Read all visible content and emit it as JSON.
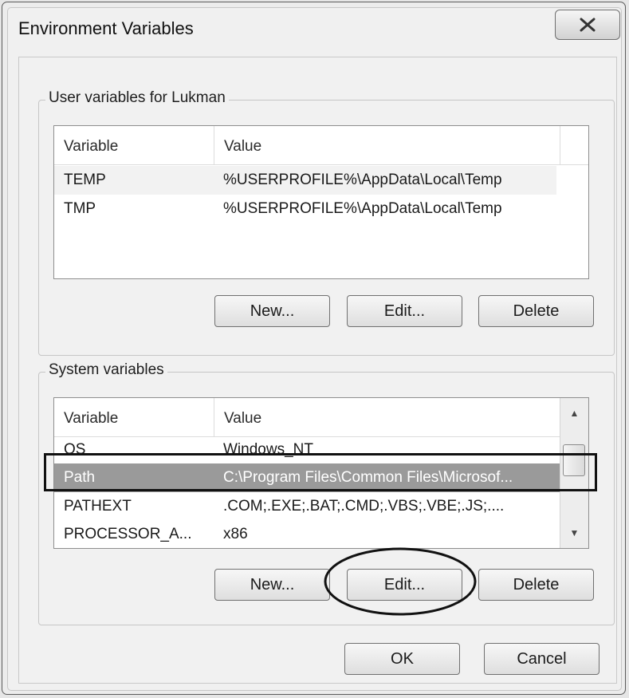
{
  "window": {
    "title": "Environment Variables",
    "close_symbol": "X"
  },
  "user_vars": {
    "label": "User variables for Lukman",
    "columns": [
      "Variable",
      "Value"
    ],
    "rows": [
      {
        "variable": "TEMP",
        "value": "%USERPROFILE%\\AppData\\Local\\Temp"
      },
      {
        "variable": "TMP",
        "value": "%USERPROFILE%\\AppData\\Local\\Temp"
      }
    ],
    "buttons": {
      "new": "New...",
      "edit": "Edit...",
      "delete": "Delete"
    }
  },
  "system_vars": {
    "label": "System variables",
    "columns": [
      "Variable",
      "Value"
    ],
    "rows": [
      {
        "variable": "OS",
        "value": "Windows_NT"
      },
      {
        "variable": "Path",
        "value": "C:\\Program Files\\Common Files\\Microsof..."
      },
      {
        "variable": "PATHEXT",
        "value": ".COM;.EXE;.BAT;.CMD;.VBS;.VBE;.JS;...."
      },
      {
        "variable": "PROCESSOR_A...",
        "value": "x86"
      }
    ],
    "buttons": {
      "new": "New...",
      "edit": "Edit...",
      "delete": "Delete"
    }
  },
  "footer": {
    "ok": "OK",
    "cancel": "Cancel"
  }
}
